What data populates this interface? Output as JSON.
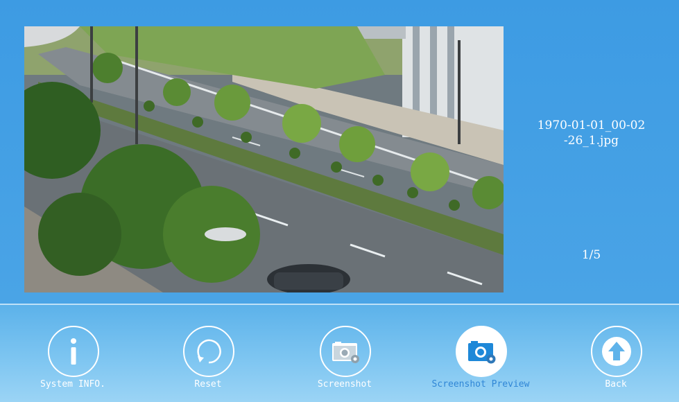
{
  "preview": {
    "image_description_icon": "street-photo",
    "filename_line1": "1970-01-01_00-02",
    "filename_line2": "-26_1.jpg",
    "page_indicator": "1/5"
  },
  "toolbar": {
    "items": [
      {
        "label": "System INFO.",
        "icon": "info-icon",
        "active": false
      },
      {
        "label": "Reset",
        "icon": "reset-icon",
        "active": false
      },
      {
        "label": "Screenshot",
        "icon": "screenshot-icon",
        "active": false
      },
      {
        "label": "Screenshot Preview",
        "icon": "screenshot-preview-icon",
        "active": true
      },
      {
        "label": "Back",
        "icon": "back-arrow-icon",
        "active": false
      }
    ]
  },
  "colors": {
    "background": "#3f9ee4",
    "toolbar_background": "#7dc5f1",
    "active_label": "#2f86d6",
    "text": "#ffffff"
  }
}
